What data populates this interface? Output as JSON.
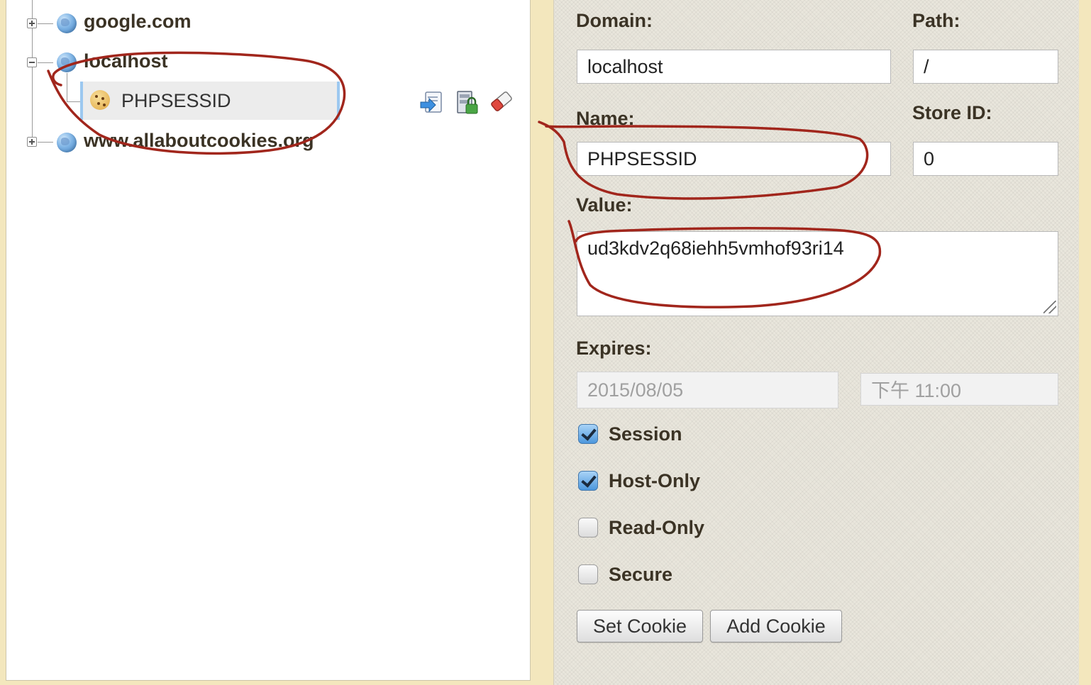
{
  "tree": {
    "domains": [
      {
        "name": "google.com",
        "expanded": false
      },
      {
        "name": "localhost",
        "expanded": true,
        "cookies": [
          {
            "name": "PHPSESSID"
          }
        ]
      },
      {
        "name": "www.allaboutcookies.org",
        "expanded": false
      }
    ],
    "icons": {
      "domain": "globe-icon",
      "cookie": "cookie-icon",
      "actions": [
        "export-cookie-icon",
        "protect-cookie-icon",
        "delete-cookie-icon"
      ]
    }
  },
  "form": {
    "domain_label": "Domain:",
    "domain_value": "localhost",
    "path_label": "Path:",
    "path_value": "/",
    "name_label": "Name:",
    "name_value": "PHPSESSID",
    "store_id_label": "Store ID:",
    "store_id_value": "0",
    "value_label": "Value:",
    "value_value": "ud3kdv2q68iehh5vmhof93ri14",
    "expires_label": "Expires:",
    "expires_date": "2015/08/05",
    "expires_time": "下午 11:00",
    "checkboxes": [
      {
        "label": "Session",
        "checked": true
      },
      {
        "label": "Host-Only",
        "checked": true
      },
      {
        "label": "Read-Only",
        "checked": false
      },
      {
        "label": "Secure",
        "checked": false
      }
    ],
    "buttons": {
      "set_cookie": "Set Cookie",
      "add_cookie": "Add Cookie"
    }
  },
  "colors": {
    "annotation": "#a1261c",
    "selection_border": "#9cc8f0",
    "checkbox_checked": "#4c97dd",
    "background": "#f3e7bd"
  }
}
